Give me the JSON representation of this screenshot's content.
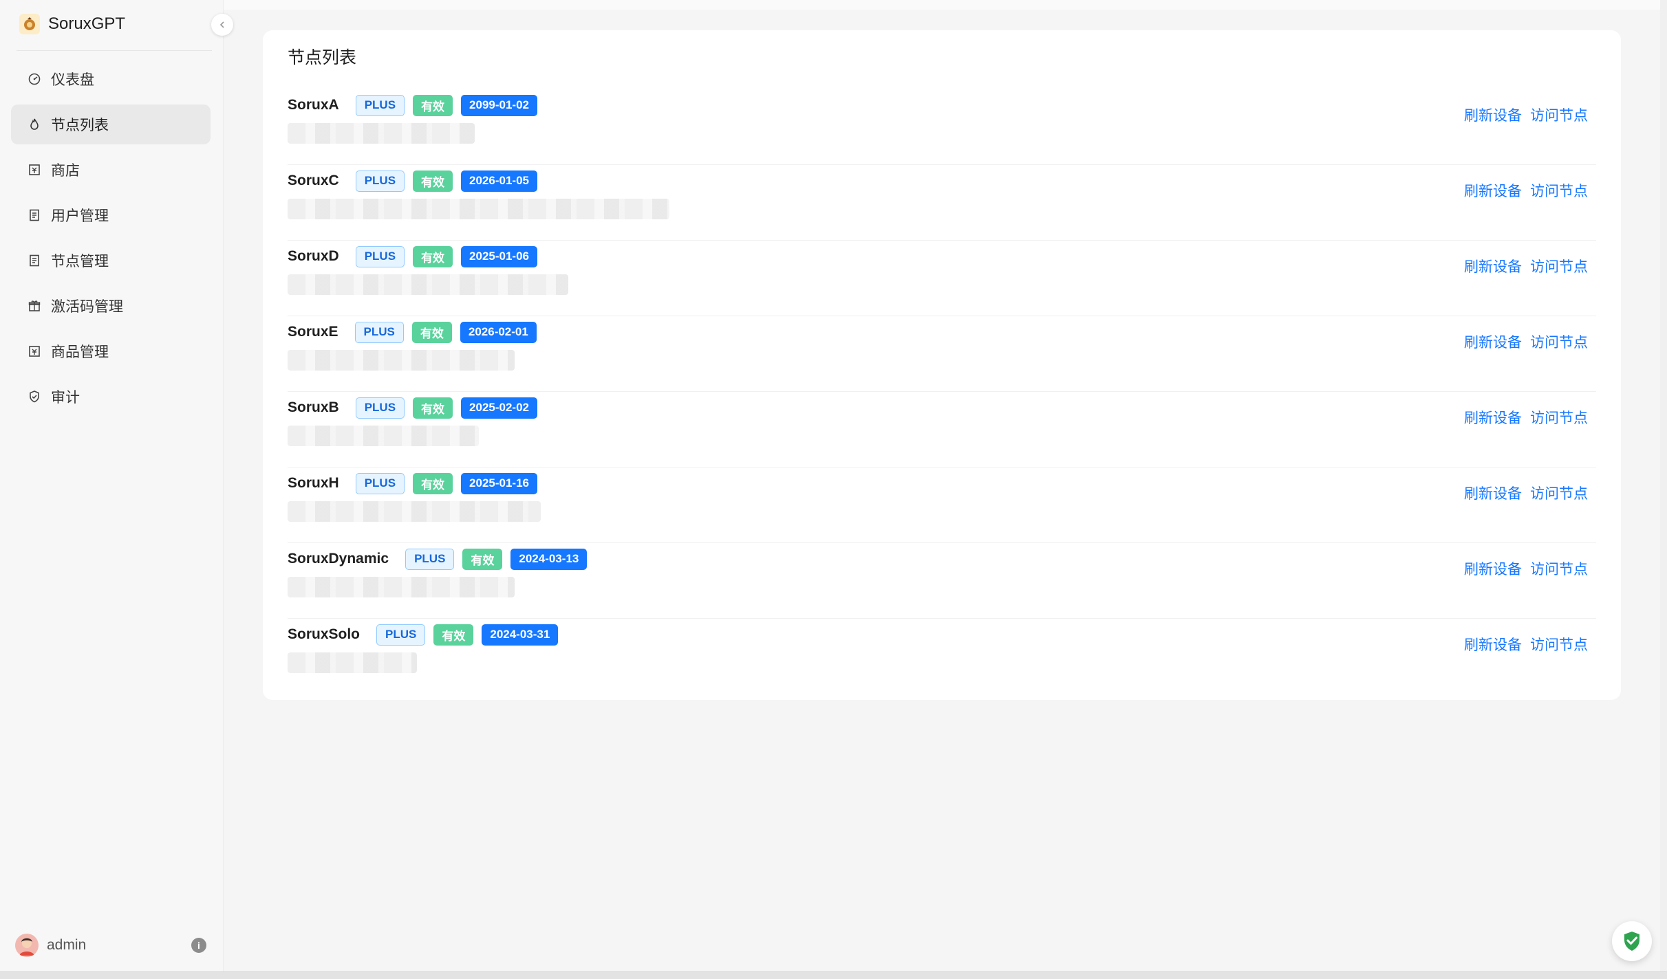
{
  "app": {
    "name": "SoruxGPT",
    "logo_icon": "avatar-logo-icon"
  },
  "sidebar": {
    "items": [
      {
        "label": "仪表盘",
        "icon": "dashboard-icon",
        "active": false
      },
      {
        "label": "节点列表",
        "icon": "fire-icon",
        "active": true
      },
      {
        "label": "商店",
        "icon": "shop-icon",
        "active": false
      },
      {
        "label": "用户管理",
        "icon": "document-icon",
        "active": false
      },
      {
        "label": "节点管理",
        "icon": "document-icon",
        "active": false
      },
      {
        "label": "激活码管理",
        "icon": "gift-icon",
        "active": false
      },
      {
        "label": "商品管理",
        "icon": "shop-icon",
        "active": false
      },
      {
        "label": "审计",
        "icon": "shield-check-icon",
        "active": false
      }
    ]
  },
  "user": {
    "name": "admin"
  },
  "main": {
    "title": "节点列表",
    "actions": {
      "refresh": "刷新设备",
      "visit": "访问节点"
    },
    "nodes": [
      {
        "name": "SoruxA",
        "plan": "PLUS",
        "status": "有效",
        "expiry": "2099-01-02"
      },
      {
        "name": "SoruxC",
        "plan": "PLUS",
        "status": "有效",
        "expiry": "2026-01-05"
      },
      {
        "name": "SoruxD",
        "plan": "PLUS",
        "status": "有效",
        "expiry": "2025-01-06"
      },
      {
        "name": "SoruxE",
        "plan": "PLUS",
        "status": "有效",
        "expiry": "2026-02-01"
      },
      {
        "name": "SoruxB",
        "plan": "PLUS",
        "status": "有效",
        "expiry": "2025-02-02"
      },
      {
        "name": "SoruxH",
        "plan": "PLUS",
        "status": "有效",
        "expiry": "2025-01-16"
      },
      {
        "name": "SoruxDynamic",
        "plan": "PLUS",
        "status": "有效",
        "expiry": "2024-03-13"
      },
      {
        "name": "SoruxSolo",
        "plan": "PLUS",
        "status": "有效",
        "expiry": "2024-03-31"
      }
    ]
  },
  "colors": {
    "accent": "#1677ff",
    "valid": "#59d29c",
    "plus_bg": "#e6f4ff",
    "secure": "#2ea44f"
  }
}
